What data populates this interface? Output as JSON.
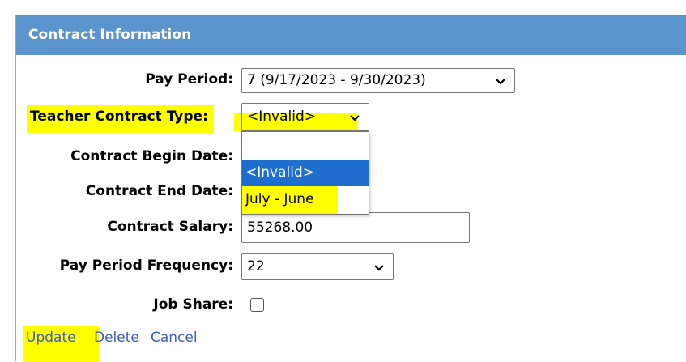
{
  "header": {
    "title": "Contract Information"
  },
  "form": {
    "pay_period": {
      "label": "Pay Period:",
      "value": "7 (9/17/2023 - 9/30/2023)"
    },
    "contract_type": {
      "label": "Teacher Contract Type:",
      "value": "<Invalid>",
      "options": [
        "",
        "<Invalid>",
        "July - June"
      ],
      "selected_option": "<Invalid>"
    },
    "begin_date": {
      "label": "Contract Begin Date:"
    },
    "end_date": {
      "label": "Contract End Date:"
    },
    "salary": {
      "label": "Contract Salary:",
      "value": "55268.00"
    },
    "frequency": {
      "label": "Pay Period Frequency:",
      "value": "22"
    },
    "job_share": {
      "label": "Job Share:",
      "checked": false
    }
  },
  "actions": {
    "update": "Update",
    "delete": "Delete",
    "cancel": "Cancel"
  },
  "colors": {
    "header_bg": "#5b94cc",
    "highlight": "#ffff00",
    "selected_option": "#1e6fcd",
    "link": "#3b5fb5"
  }
}
